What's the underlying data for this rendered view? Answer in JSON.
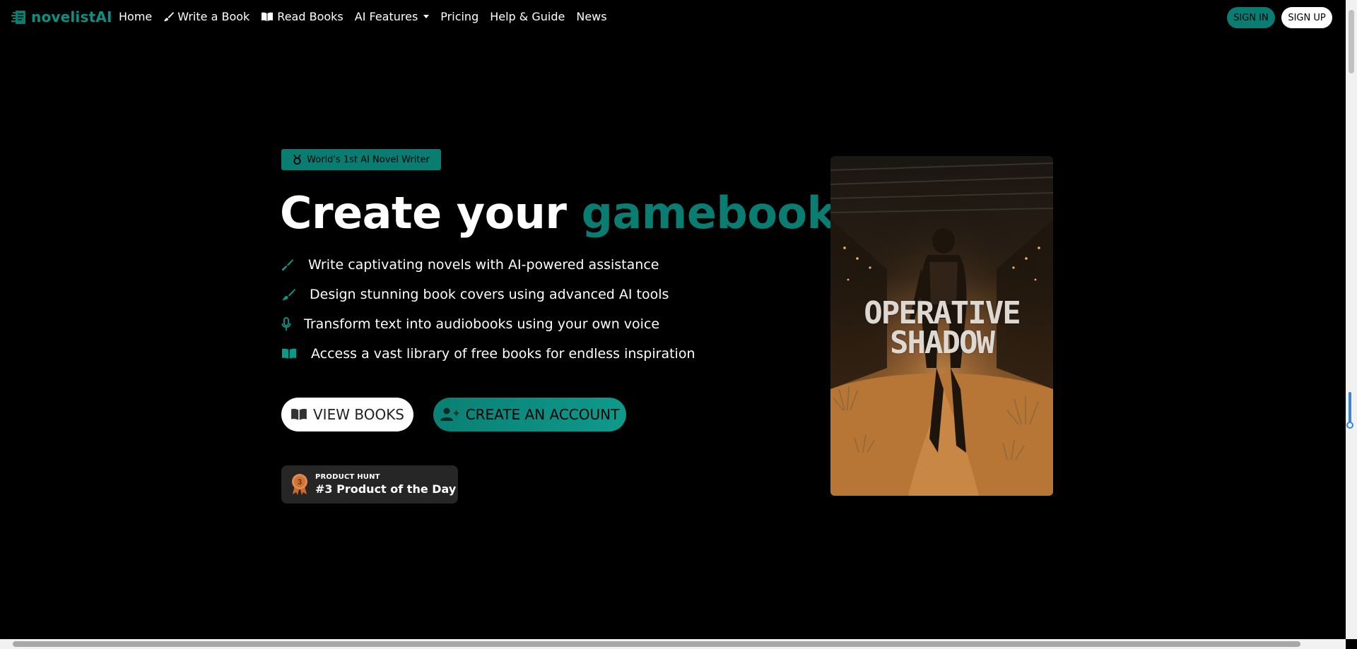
{
  "nav": {
    "brand": "novelistAI",
    "links": [
      {
        "label": "Home"
      },
      {
        "label": "Write a Book",
        "icon": "brush-icon"
      },
      {
        "label": "Read Books",
        "icon": "book-icon"
      },
      {
        "label": "AI Features",
        "dropdown": true
      },
      {
        "label": "Pricing"
      },
      {
        "label": "Help & Guide"
      },
      {
        "label": "News"
      }
    ],
    "sign_in": "SIGN IN",
    "sign_up": "SIGN UP"
  },
  "hero": {
    "badge": "World's 1st AI Novel Writer",
    "headline_prefix": "Create your",
    "headline_accent": "gamebooks",
    "features": [
      {
        "icon": "pen-icon",
        "text": "Write captivating novels with AI-powered assistance"
      },
      {
        "icon": "brush-icon",
        "text": "Design stunning book covers using advanced AI tools"
      },
      {
        "icon": "microphone-icon",
        "text": "Transform text into audiobooks using your own voice"
      },
      {
        "icon": "book-open-icon",
        "text": "Access a vast library of free books for endless inspiration"
      }
    ],
    "view_books": "VIEW BOOKS",
    "create_account": "CREATE AN ACCOUNT",
    "product_hunt": {
      "label": "PRODUCT HUNT",
      "title": "#3 Product of the Day",
      "rank": "3"
    },
    "cover_title": [
      "OPERATIVE",
      "SHADOW"
    ]
  },
  "colors": {
    "accent": "#0a7d72",
    "background": "#000000",
    "text": "#ffffff"
  }
}
